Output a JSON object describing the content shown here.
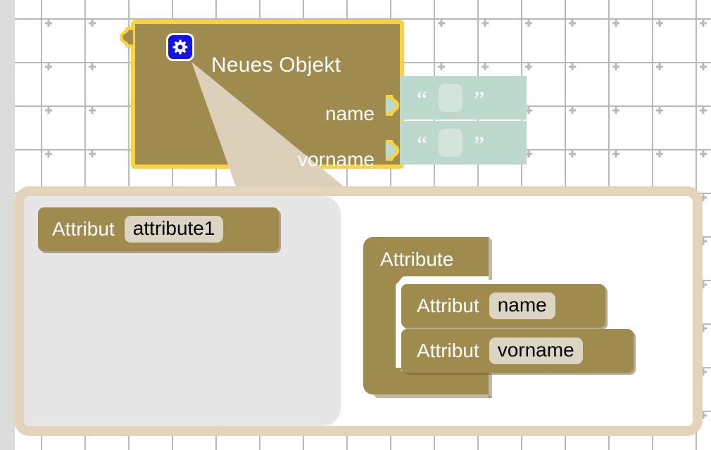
{
  "app": {
    "kind": "blockly-workspace",
    "language": "de"
  },
  "workspace": {
    "grid": {
      "spacing_px": 62,
      "marker": "plus-cross",
      "marker_color": "#b9b9b9"
    },
    "background_color": "#ffffff",
    "left_rail_color": "#dcdcdc"
  },
  "colors": {
    "block_fill": "#a08b4f",
    "block_shadow": "#78643780",
    "selection_highlight": "#fcd33f",
    "string_block_fill": "#bdd8cd",
    "string_field_fill": "#d2e4db",
    "text_field_fill": "#ddd5c3",
    "mutator_border": "#e3d4bc",
    "mutator_background": "#ffffff",
    "flyout_background": "#e6e6e6",
    "gear_badge_fill": "#1414e6",
    "label_text": "#ffffff",
    "field_text": "#000000"
  },
  "main_block": {
    "selected": true,
    "icon": "gear-icon",
    "title": "Neues Objekt",
    "rows": [
      {
        "label": "name",
        "value_block": {
          "type": "text",
          "open_quote": "“",
          "close_quote": "”",
          "value": ""
        }
      },
      {
        "label": "vorname",
        "value_block": {
          "type": "text",
          "open_quote": "“",
          "close_quote": "”",
          "value": ""
        }
      }
    ]
  },
  "mutator": {
    "open": true,
    "flyout": {
      "blocks": [
        {
          "label": "Attribut",
          "field_value": "attribute1"
        }
      ]
    },
    "container": {
      "label": "Attribute",
      "children": [
        {
          "label": "Attribut",
          "field_value": "name"
        },
        {
          "label": "Attribut",
          "field_value": "vorname"
        }
      ]
    }
  }
}
